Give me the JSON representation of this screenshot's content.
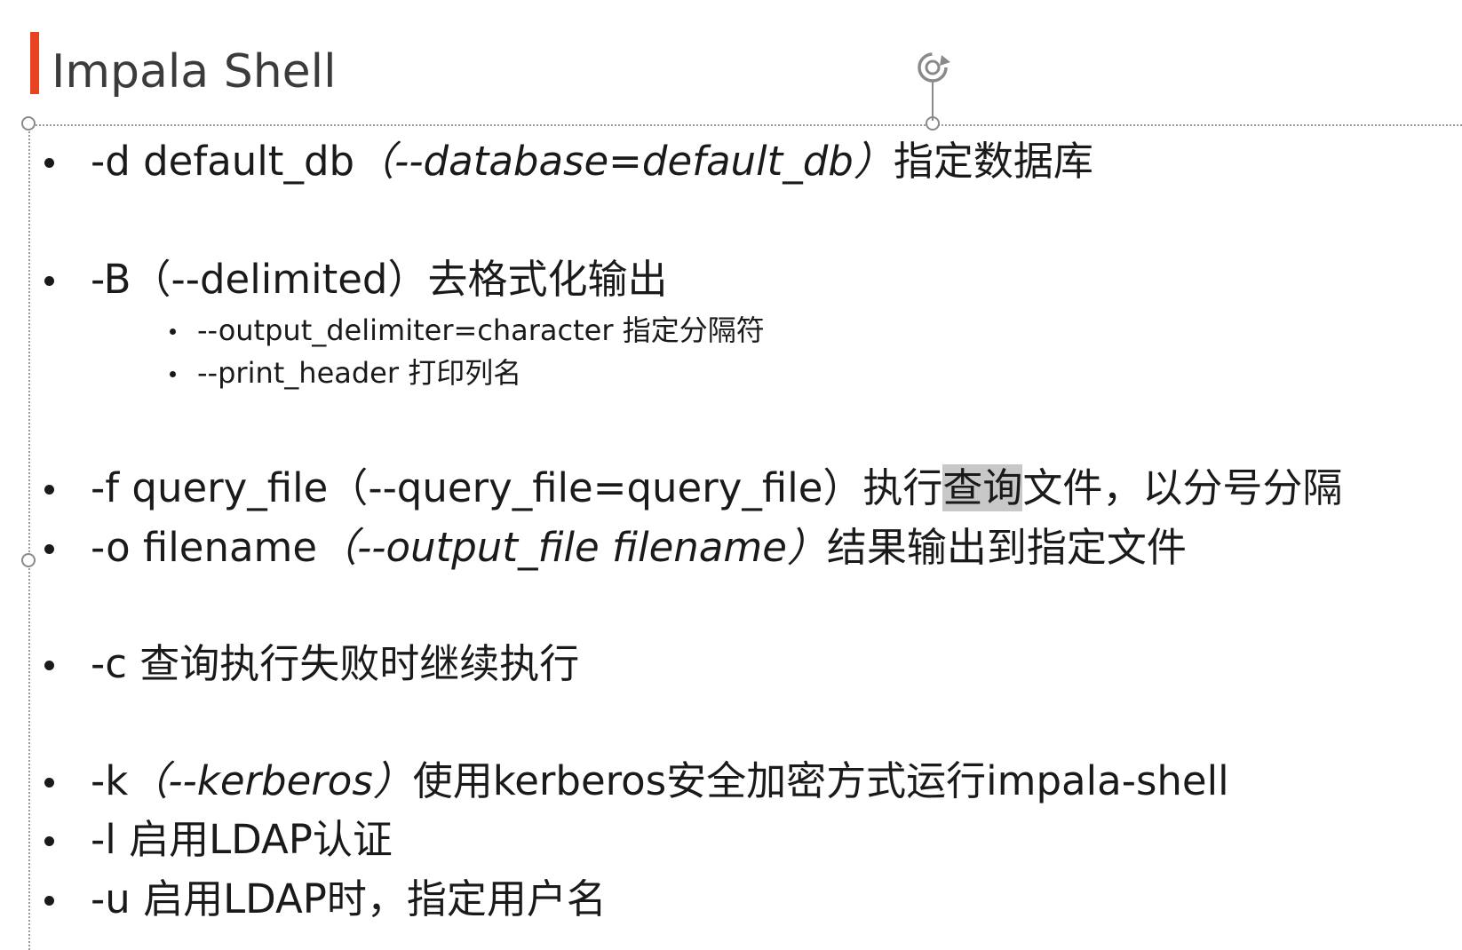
{
  "slide": {
    "title": "Impala Shell"
  },
  "items": [
    {
      "option": "-d default_db",
      "paren": "（--database=default_db）",
      "desc": "指定数据库"
    },
    {
      "option": "-B",
      "paren": "（--delimited）",
      "desc": "去格式化输出",
      "sub": [
        "--output_delimiter=character 指定分隔符",
        "--print_header 打印列名"
      ]
    },
    {
      "option": "-f query_file",
      "paren": "（--query_file=query_file）",
      "desc_pre": "执行",
      "desc_hl": "查询",
      "desc_post": "文件，以分号分隔"
    },
    {
      "option": "-o filename",
      "paren": "（--output_file filename）",
      "desc": "结果输出到指定文件"
    },
    {
      "option": "-c",
      "desc": "查询执行失败时继续执行"
    },
    {
      "option": "-k",
      "paren": "（--kerberos）",
      "desc": "使用kerberos安全加密方式运行impala-shell"
    },
    {
      "option": "-l",
      "desc": "启用LDAP认证"
    },
    {
      "option": "-u",
      "desc": "启用LDAP时，指定用户名"
    }
  ],
  "colors": {
    "accent": "#e8431f",
    "text": "#1a1a1a",
    "highlight": "#c8c8c8",
    "frame": "#9a9a9a"
  },
  "icons": [
    "rotate-handle-icon"
  ]
}
